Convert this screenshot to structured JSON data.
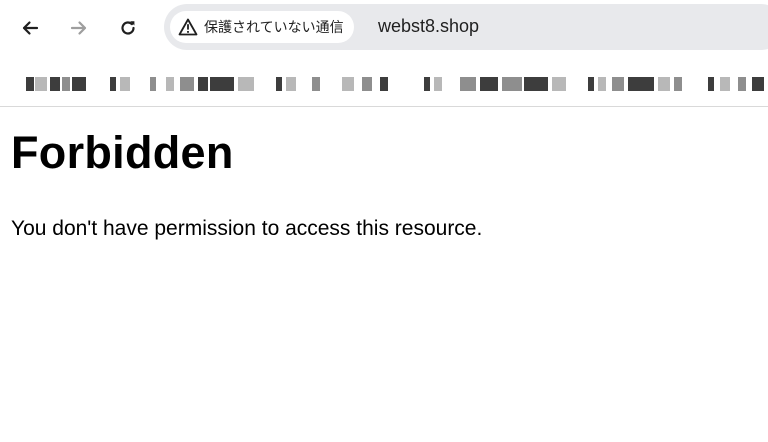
{
  "browser": {
    "security_label": "保護されていない通信",
    "url": "webst8.shop"
  },
  "icons": {
    "back": "arrow-left-icon",
    "forward": "arrow-right-icon",
    "reload": "reload-icon",
    "security": "warning-triangle-icon"
  },
  "colors": {
    "omnibox_bg": "#e8e9ec",
    "forward_disabled": "#9e9e9e"
  },
  "page": {
    "heading": "Forbidden",
    "message": "You don't have permission to access this resource."
  }
}
